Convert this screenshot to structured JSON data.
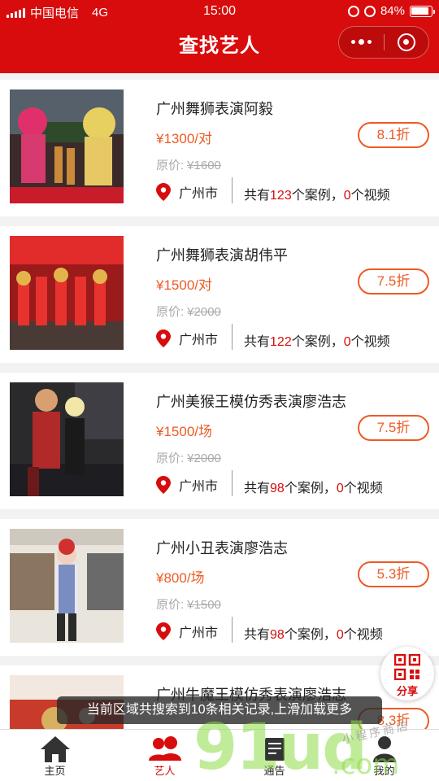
{
  "status_bar": {
    "carrier": "中国电信",
    "network": "4G",
    "time": "15:00",
    "battery": "84%"
  },
  "header": {
    "title": "查找艺人"
  },
  "artists": [
    {
      "name": "广州舞狮表演阿毅",
      "price": "¥1300/对",
      "original_label": "原价:",
      "original_price": "¥1600",
      "discount": "8.1折",
      "city": "广州市",
      "cases": "123",
      "videos": "0",
      "photo": "lion-dance-stage"
    },
    {
      "name": "广州舞狮表演胡伟平",
      "price": "¥1500/对",
      "original_label": "原价:",
      "original_price": "¥2000",
      "discount": "7.5折",
      "city": "广州市",
      "cases": "122",
      "videos": "0",
      "photo": "lion-dance-banners"
    },
    {
      "name": "广州美猴王模仿秀表演廖浩志",
      "price": "¥1500/场",
      "original_label": "原价:",
      "original_price": "¥2000",
      "discount": "7.5折",
      "city": "广州市",
      "cases": "98",
      "videos": "0",
      "photo": "monkey-king-performer"
    },
    {
      "name": "广州小丑表演廖浩志",
      "price": "¥800/场",
      "original_label": "原价:",
      "original_price": "¥1500",
      "discount": "5.3折",
      "city": "广州市",
      "cases": "98",
      "videos": "0",
      "photo": "clown-in-store"
    },
    {
      "name": "广州牛魔王模仿秀表演廖浩志",
      "price": "",
      "original_label": "",
      "original_price": "",
      "discount": "8.3折",
      "city": "",
      "cases": "",
      "videos": "",
      "photo": "bull-demon-performer"
    }
  ],
  "stats_text": {
    "prefix": "共有",
    "cases_suffix": "个案例，",
    "videos_suffix": "个视频"
  },
  "share_button": {
    "label": "分享",
    "icon": "qr-code-icon"
  },
  "toast": "当前区域共搜索到10条相关记录,上滑加载更多",
  "tabbar": [
    {
      "label": "主页",
      "icon": "home-icon",
      "active": false
    },
    {
      "label": "艺人",
      "icon": "users-icon",
      "active": true
    },
    {
      "label": "通告",
      "icon": "notice-icon",
      "active": false
    },
    {
      "label": "我的",
      "icon": "user-icon",
      "active": false
    }
  ],
  "watermark": {
    "brand": "91ud",
    "sub": "小程序商店",
    "domain": ".com"
  },
  "colors": {
    "primary": "#d80c0c",
    "accent": "#ee5a24",
    "muted": "#aaaaaa"
  }
}
